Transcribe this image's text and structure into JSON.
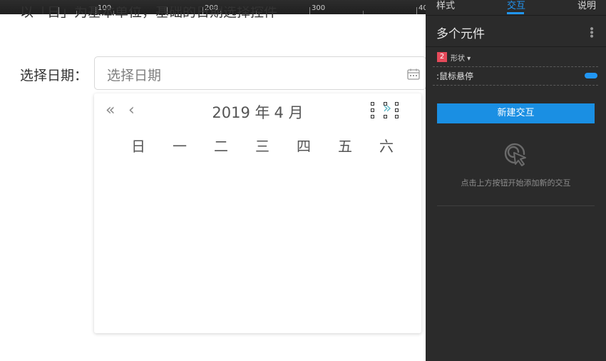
{
  "ruler": {
    "labels": [
      "100",
      "200",
      "300",
      "40"
    ]
  },
  "canvas": {
    "intro_text": "以「日」为基本单位，基础的日期选择控件",
    "field_label": "选择日期：",
    "input_placeholder": "选择日期",
    "calendar_icon": "calendar-icon",
    "picker": {
      "year": "2019 年",
      "month": "4 月",
      "nav_icons": [
        "double-chevron-left-icon",
        "chevron-left-icon",
        "chevron-right-icon"
      ],
      "weekdays": [
        "日",
        "一",
        "二",
        "三",
        "四",
        "五",
        "六"
      ]
    }
  },
  "panel": {
    "tabs": [
      "样式",
      "交互",
      "说明"
    ],
    "active_tab": "交互",
    "title": "多个元件",
    "shape_count": "2",
    "shape_label": "形状 ▾",
    "event_label": ":鼠标悬停",
    "new_button": "新建交互",
    "hint": "点击上方按钮开始添加新的交互",
    "accent_color": "#2196f3",
    "badge_color": "#e64a5a"
  }
}
